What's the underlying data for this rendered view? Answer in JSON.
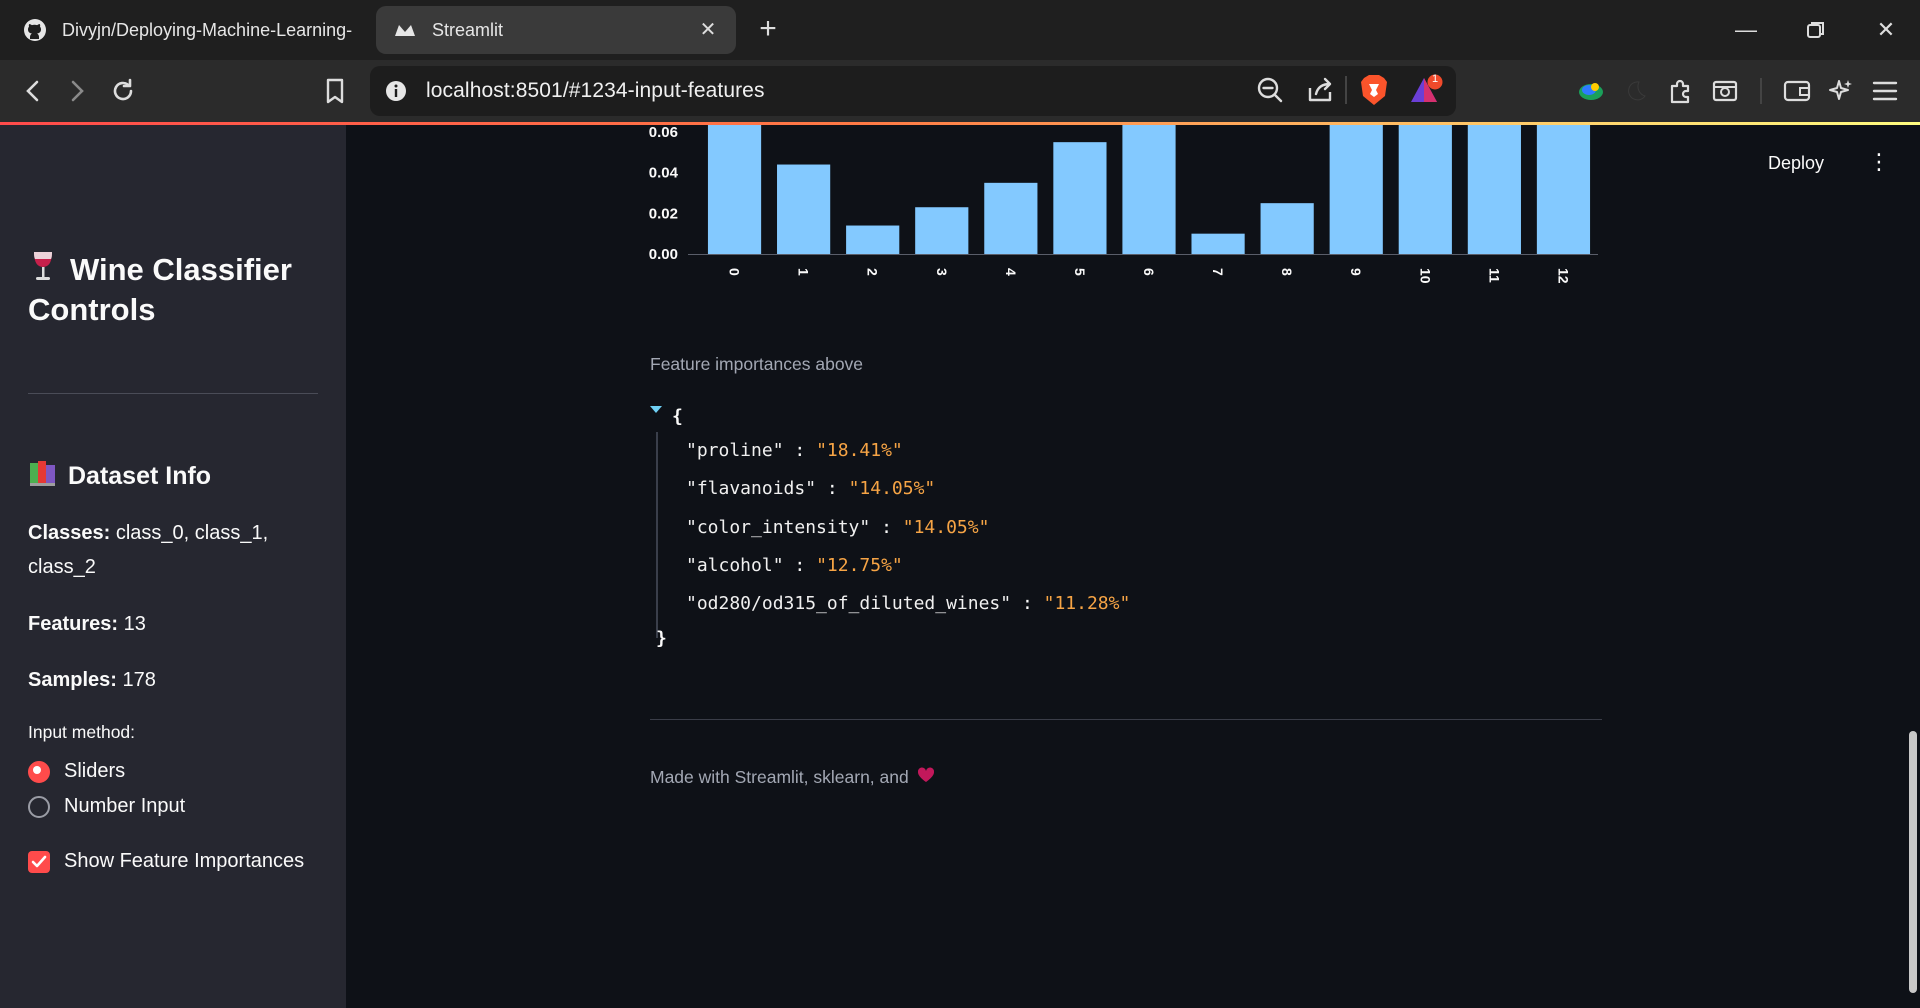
{
  "browser": {
    "tabs": [
      {
        "title": "Divyjn/Deploying-Machine-Learning-",
        "icon": "github-icon"
      },
      {
        "title": "Streamlit",
        "icon": "streamlit-icon"
      }
    ],
    "url": "localhost:8501/#1234-input-features",
    "notification_count": "1"
  },
  "app": {
    "deploy_label": "Deploy",
    "sidebar": {
      "title": "Wine Classifier Controls",
      "title_icon": "wine-glass-icon",
      "dataset_heading": "Dataset Info",
      "dataset_icon": "books-icon",
      "classes_label": "Classes:",
      "classes_value": "class_0, class_1, class_2",
      "features_label": "Features:",
      "features_value": "13",
      "samples_label": "Samples:",
      "samples_value": "178",
      "input_method_label": "Input method:",
      "input_options": [
        "Sliders",
        "Number Input"
      ],
      "selected_input": "Sliders",
      "show_importances_label": "Show Feature Importances",
      "show_importances_checked": true
    },
    "caption": "Feature importances above",
    "json_view": [
      {
        "key": "\"proline\"",
        "value": "\"18.41%\""
      },
      {
        "key": "\"flavanoids\"",
        "value": "\"14.05%\""
      },
      {
        "key": "\"color_intensity\"",
        "value": "\"14.05%\""
      },
      {
        "key": "\"alcohol\"",
        "value": "\"12.75%\""
      },
      {
        "key": "\"od280/od315_of_diluted_wines\"",
        "value": "\"11.28%\""
      }
    ],
    "footer_text": "Made with Streamlit, sklearn, and",
    "footer_icon": "heart-icon"
  },
  "colors": {
    "bar": "#83c9ff",
    "accent": "#ff4b4b",
    "json_value": "#f6a445"
  },
  "chart_data": {
    "type": "bar",
    "categories": [
      "0",
      "1",
      "2",
      "3",
      "4",
      "5",
      "6",
      "7",
      "8",
      "9",
      "10",
      "11",
      "12"
    ],
    "values": [
      0.07,
      0.044,
      0.014,
      0.023,
      0.035,
      0.055,
      0.07,
      0.01,
      0.025,
      0.07,
      0.07,
      0.07,
      0.07
    ],
    "y_ticks": [
      "0.00",
      "0.02",
      "0.04",
      "0.06"
    ],
    "ylim": [
      0,
      0.064
    ],
    "visible_ylim_note": "",
    "title": "",
    "xlabel": "",
    "ylabel": ""
  }
}
